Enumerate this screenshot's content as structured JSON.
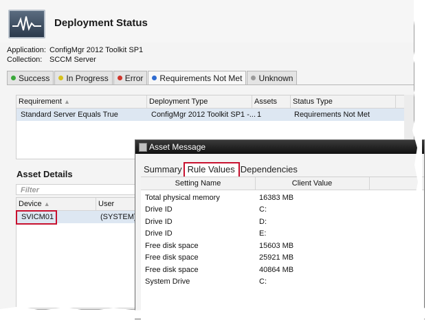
{
  "header": {
    "title": "Deployment Status",
    "icon": "monitor-graph-icon"
  },
  "meta": [
    {
      "label": "Application:",
      "value": "ConfigMgr 2012 Toolkit SP1"
    },
    {
      "label": "Collection:",
      "value": "SCCM Server"
    }
  ],
  "tabs": [
    {
      "label": "Success",
      "color": "#3aa83a"
    },
    {
      "label": "In Progress",
      "color": "#d6c11e"
    },
    {
      "label": "Error",
      "color": "#d0362c"
    },
    {
      "label": "Requirements Not Met",
      "color": "#2e6bd0",
      "active": true
    },
    {
      "label": "Unknown",
      "color": "#9a9a9a"
    }
  ],
  "deployments": {
    "columns": [
      "Requirement",
      "Deployment Type",
      "Assets",
      "Status Type"
    ],
    "rows": [
      [
        "Standard Server Equals True",
        "ConfigMgr 2012 Toolkit SP1 -...",
        "1",
        "Requirements Not Met"
      ]
    ]
  },
  "asset_details": {
    "heading": "Asset Details",
    "filter_placeholder": "Filter",
    "columns": [
      "Device",
      "User"
    ],
    "rows": [
      [
        "SVICM01",
        "(SYSTEM)"
      ]
    ]
  },
  "dialog": {
    "title": "Asset Message",
    "tabs": [
      "Summary",
      "Rule Values",
      "Dependencies"
    ],
    "active_tab": "Rule Values",
    "columns": [
      "Setting Name",
      "Client Value"
    ],
    "rows": [
      [
        "Total physical memory",
        "16383 MB"
      ],
      [
        "Drive ID",
        "C:"
      ],
      [
        "Drive ID",
        "D:"
      ],
      [
        "Drive ID",
        "E:"
      ],
      [
        "Free disk space",
        "15603 MB"
      ],
      [
        "Free disk space",
        "25921 MB"
      ],
      [
        "Free disk space",
        "40864 MB"
      ],
      [
        "System Drive",
        "C:"
      ]
    ]
  },
  "colors": {
    "highlight": "#c8102e",
    "selected_row": "#dde7f2"
  }
}
